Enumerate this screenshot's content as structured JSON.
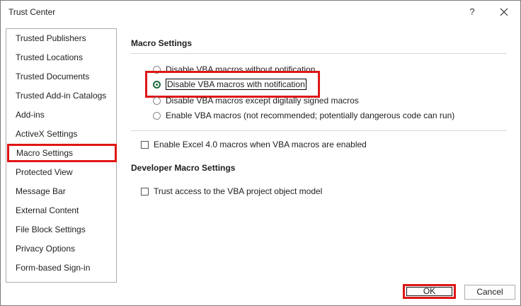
{
  "window": {
    "title": "Trust Center",
    "help_glyph": "?",
    "close_icon": "close-icon"
  },
  "sidebar": {
    "items": [
      {
        "label": "Trusted Publishers"
      },
      {
        "label": "Trusted Locations"
      },
      {
        "label": "Trusted Documents"
      },
      {
        "label": "Trusted Add-in Catalogs"
      },
      {
        "label": "Add-ins"
      },
      {
        "label": "ActiveX Settings"
      },
      {
        "label": "Macro Settings",
        "selected": true
      },
      {
        "label": "Protected View"
      },
      {
        "label": "Message Bar"
      },
      {
        "label": "External Content"
      },
      {
        "label": "File Block Settings"
      },
      {
        "label": "Privacy Options"
      },
      {
        "label": "Form-based Sign-in"
      }
    ]
  },
  "macro_settings": {
    "title": "Macro Settings",
    "options": [
      {
        "label": "Disable VBA macros without notification",
        "checked": false
      },
      {
        "label": "Disable VBA macros with notification",
        "checked": true
      },
      {
        "label": "Disable VBA macros except digitally signed macros",
        "checked": false
      },
      {
        "label": "Enable VBA macros (not recommended; potentially dangerous code can run)",
        "checked": false
      }
    ],
    "excel4_label": "Enable Excel 4.0 macros when VBA macros are enabled",
    "excel4_checked": false
  },
  "developer_settings": {
    "title": "Developer Macro Settings",
    "trust_vba_label": "Trust access to the VBA project object model",
    "trust_vba_checked": false
  },
  "buttons": {
    "ok": "OK",
    "cancel": "Cancel"
  },
  "colors": {
    "highlight": "#e01616",
    "radio_accent": "#1e6b3a"
  }
}
